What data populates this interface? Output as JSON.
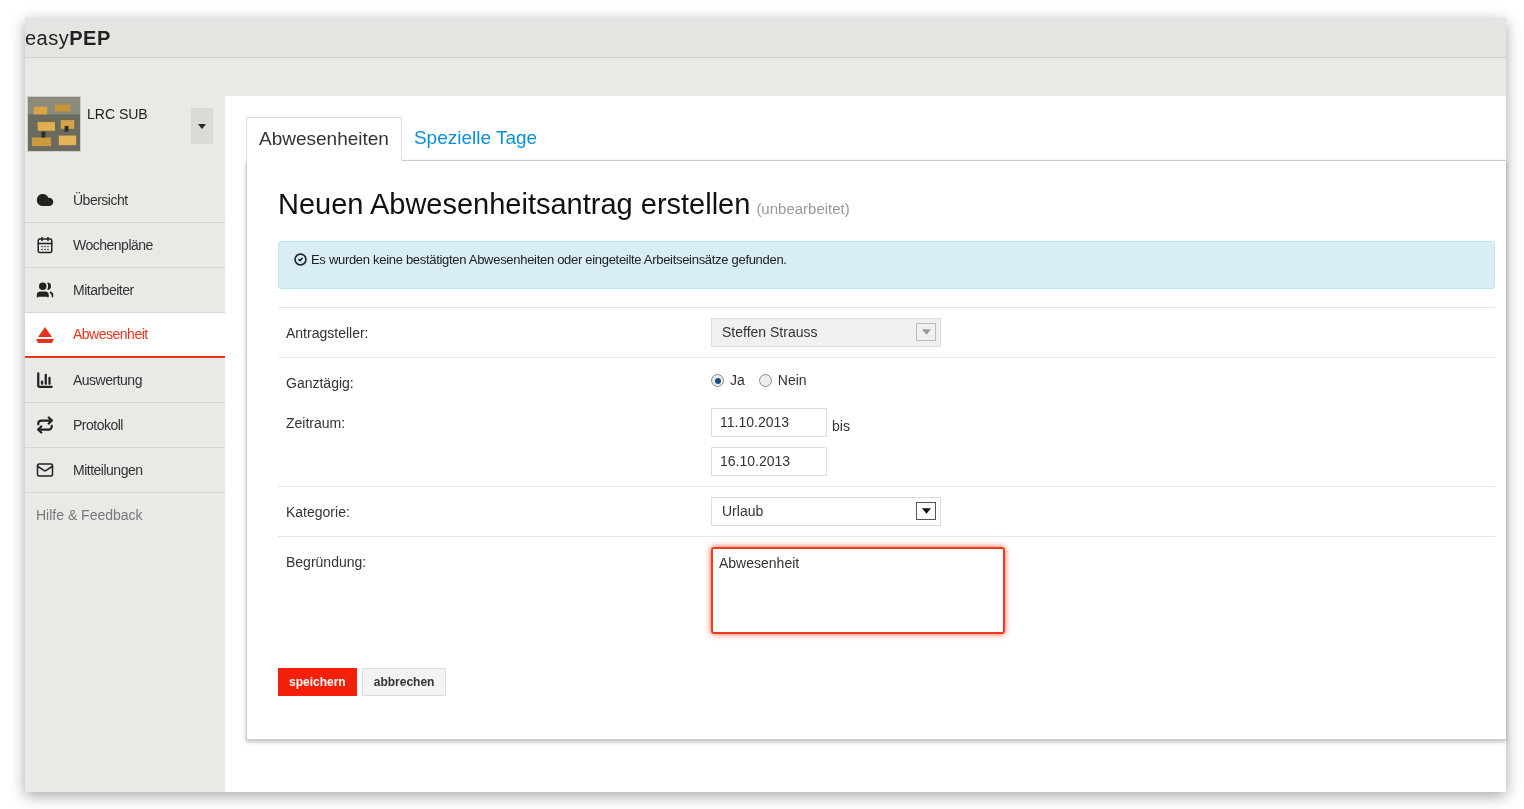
{
  "app": {
    "logo_light": "easy",
    "logo_bold": "PEP"
  },
  "account": {
    "name": "LRC SUB"
  },
  "sidebar": {
    "items": [
      {
        "label": "Übersicht",
        "selected": false
      },
      {
        "label": "Wochenpläne",
        "selected": false
      },
      {
        "label": "Mitarbeiter",
        "selected": false
      },
      {
        "label": "Abwesenheit",
        "selected": true
      },
      {
        "label": "Auswertung",
        "selected": false
      },
      {
        "label": "Protokoll",
        "selected": false
      },
      {
        "label": "Mitteilungen",
        "selected": false
      }
    ],
    "help": "Hilfe & Feedback"
  },
  "tabs": [
    {
      "label": "Abwesenheiten",
      "selected": true
    },
    {
      "label": "Spezielle Tage",
      "selected": false
    }
  ],
  "form": {
    "title": "Neuen Abwesenheitsantrag erstellen",
    "status": "(unbearbeitet)",
    "notice": "Es wurden keine bestätigten Abwesenheiten oder eingeteilte Arbeitseinsätze gefunden.",
    "rows": [
      {
        "kind": "select",
        "label": "Antragsteller:",
        "value": "Steffen Strauss",
        "disabled": true,
        "divider": true
      },
      {
        "kind": "radio",
        "label": "Ganztägig:",
        "options": [
          {
            "label": "Ja",
            "selected": true
          },
          {
            "label": "Nein",
            "selected": false
          }
        ],
        "divider": false
      },
      {
        "kind": "daterange",
        "label": "Zeitraum:",
        "from": "11.10.2013",
        "separator": "bis",
        "to": "16.10.2013",
        "divider": true
      },
      {
        "kind": "select",
        "label": "Kategorie:",
        "value": "Urlaub",
        "disabled": false,
        "divider": true
      },
      {
        "kind": "textarea",
        "label": "Begründung:",
        "value": "Abwesenheit",
        "focused": true,
        "divider": false
      }
    ],
    "buttons": [
      {
        "label": "speichern",
        "kind": "primary"
      },
      {
        "label": "abbrechen",
        "kind": "secondary"
      }
    ]
  }
}
